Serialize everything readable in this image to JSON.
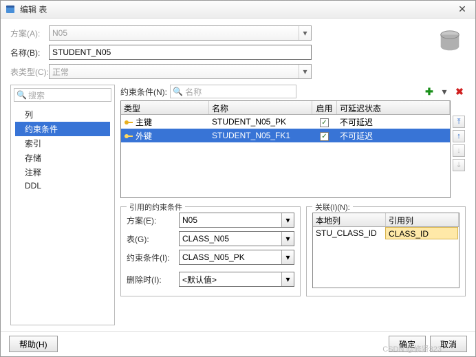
{
  "window": {
    "title": "编辑 表"
  },
  "form": {
    "schema_label": "方案(A):",
    "schema_value": "N05",
    "name_label": "名称(B):",
    "name_value": "STUDENT_N05",
    "tabletype_label": "表类型(C):",
    "tabletype_value": "正常"
  },
  "sidebar": {
    "search_placeholder": "搜索",
    "items": [
      "列",
      "约束条件",
      "索引",
      "存储",
      "注释",
      "DDL"
    ],
    "selected": 1
  },
  "constraints": {
    "label": "约束条件(N):",
    "search_placeholder": "名称",
    "headers": {
      "type": "类型",
      "name": "名称",
      "enable": "启用",
      "defer": "可延迟状态"
    },
    "rows": [
      {
        "type": "主键",
        "name": "STUDENT_N05_PK",
        "enabled": true,
        "defer": "不可延迟",
        "selected": false
      },
      {
        "type": "外键",
        "name": "STUDENT_N05_FK1",
        "enabled": true,
        "defer": "不可延迟",
        "selected": true
      }
    ]
  },
  "ref": {
    "legend": "引用的约束条件",
    "schema_label": "方案(E):",
    "schema_value": "N05",
    "table_label": "表(G):",
    "table_value": "CLASS_N05",
    "constr_label": "约束条件(I):",
    "constr_value": "CLASS_N05_PK",
    "ondelete_label": "删除时(I):",
    "ondelete_value": "<默认值>"
  },
  "rel": {
    "legend": "关联(I)(N):",
    "headers": {
      "local": "本地列",
      "ref": "引用列"
    },
    "row": {
      "local": "STU_CLASS_ID",
      "ref": "CLASS_ID"
    }
  },
  "buttons": {
    "help": "帮助(H)",
    "ok": "确定",
    "cancel": "取消"
  },
  "watermark": "CSDN @修贤323"
}
